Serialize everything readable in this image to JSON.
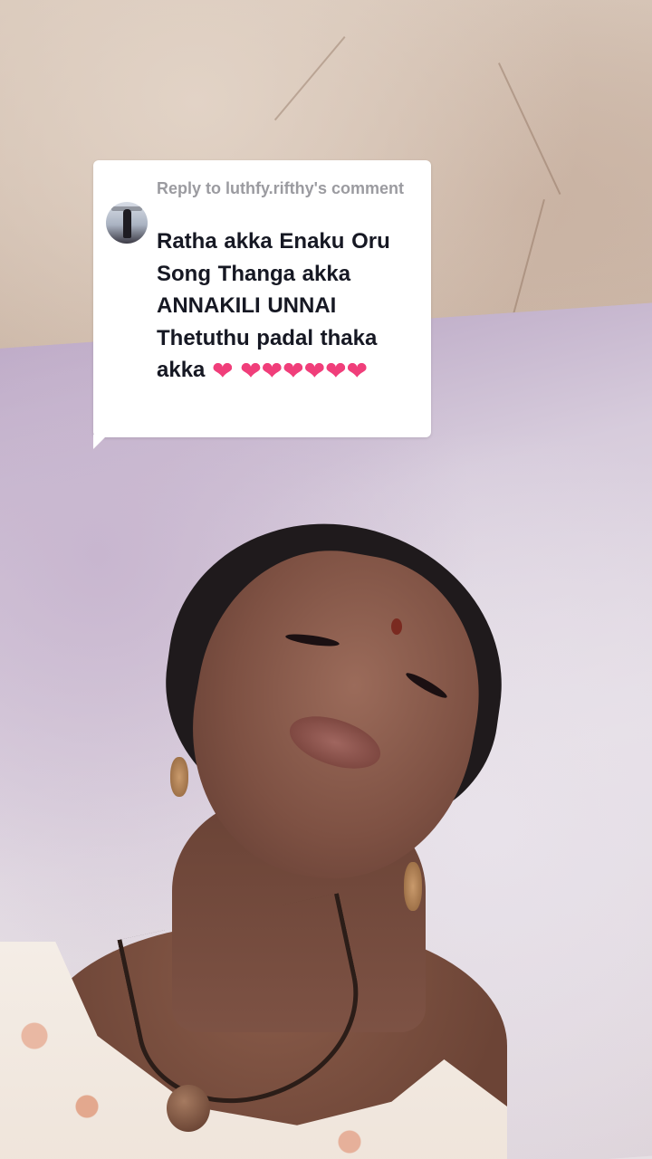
{
  "reply": {
    "header": "Reply to luthfy.rifthy's comment",
    "body_text": "Ratha akka Enaku Oru Song Thanga akka ANNAKILI UNNAI Thetuthu padal thaka akka",
    "hearts": [
      "❤",
      "❤",
      "❤",
      "❤",
      "❤",
      "❤",
      "❤"
    ],
    "heart_color": "#f03e7a"
  },
  "colors": {
    "bubble_bg": "#ffffff",
    "header_text": "#9b9ba0",
    "body_text": "#161823"
  },
  "icons": {
    "avatar": "commenter-avatar",
    "heart": "pink-heart-emoji"
  }
}
